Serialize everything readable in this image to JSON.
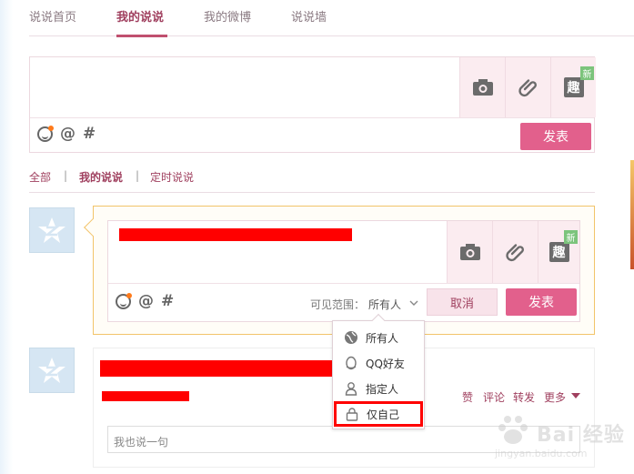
{
  "nav": {
    "tabs": [
      {
        "label": "说说首页"
      },
      {
        "label": "我的说说"
      },
      {
        "label": "我的微博"
      },
      {
        "label": "说说墙"
      }
    ],
    "active_tab": "我的说说"
  },
  "composer": {
    "publish_label": "发表",
    "new_badge": "新",
    "qu_label": "趣",
    "icons": [
      "camera-icon",
      "attachment-icon",
      "fun-icon",
      "emoji-icon",
      "at-icon",
      "hashtag-icon"
    ]
  },
  "filter": {
    "all": "全部",
    "mine": "我的说说",
    "scheduled": "定时说说",
    "separator": "|"
  },
  "edit_post": {
    "visibility_label": "可见范围：",
    "visibility_value": "所有人",
    "cancel_label": "取消",
    "publish_label": "发表",
    "new_badge": "新",
    "qu_label": "趣"
  },
  "visibility_menu": {
    "items": [
      {
        "label": "所有人",
        "icon": "globe-icon"
      },
      {
        "label": "QQ好友",
        "icon": "qq-icon"
      },
      {
        "label": "指定人",
        "icon": "person-icon"
      },
      {
        "label": "仅自己",
        "icon": "lock-icon"
      }
    ],
    "highlighted": "仅自己"
  },
  "post2": {
    "actions": {
      "like": "赞",
      "comment": "评论",
      "forward": "转发",
      "more": "更多"
    },
    "comment_placeholder": "我也说一句"
  },
  "watermark": {
    "text": "Bai 经验",
    "sub": "jingyan.baidu.com"
  },
  "colors": {
    "accent": "#a0405f",
    "button": "#e2608c",
    "highlight_border": "#ff0000",
    "edit_border": "#f2c46a"
  }
}
